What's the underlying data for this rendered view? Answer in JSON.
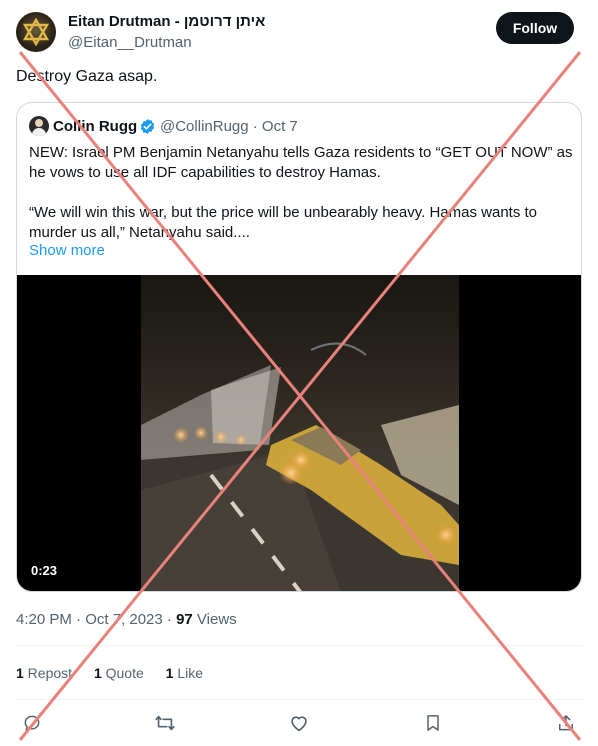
{
  "author": {
    "name": "Eitan Drutman - איתן דרוטמן",
    "handle": "@Eitan__Drutman",
    "avatar_icon": "star-of-david-icon"
  },
  "follow_label": "Follow",
  "tweet_text": "Destroy Gaza asap.",
  "quoted": {
    "name": "Collin Rugg",
    "verified_icon": "verified-badge-icon",
    "handle_date": "@CollinRugg · Oct 7",
    "paragraph1": "NEW: Israel PM Benjamin Netanyahu tells Gaza residents to “GET OUT NOW” as he vows to use all IDF capabilities to destroy Hamas.",
    "paragraph2": "“We will win this war, but the price will be unbearably heavy. Hamas wants to murder us all,” Netanyahu said....",
    "show_more": "Show more",
    "video_time": "0:23"
  },
  "meta": {
    "time_date": "4:20 PM · Oct 7, 2023 · ",
    "views_count": "97",
    "views_label": " Views"
  },
  "stats": {
    "reposts_count": "1",
    "reposts_label": " Repost",
    "quotes_count": "1",
    "quotes_label": " Quote",
    "likes_count": "1",
    "likes_label": " Like"
  },
  "actions": [
    "reply-icon",
    "retweet-icon",
    "like-icon",
    "bookmark-icon",
    "share-icon"
  ],
  "colors": {
    "accent": "#1d9bf0",
    "text": "#0f1419",
    "secondary": "#536471",
    "cross_overlay": "#e8827a"
  }
}
